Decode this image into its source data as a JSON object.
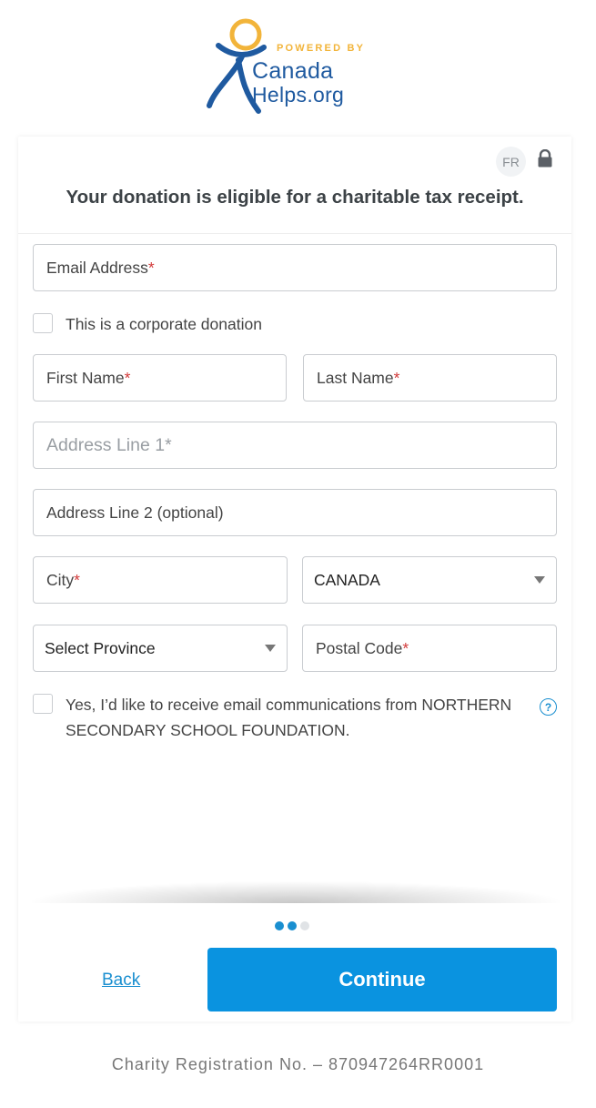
{
  "logo": {
    "powered_by": "POWERED BY",
    "line1": "Canada",
    "line2_main": "Helps",
    "line2_suffix": ".org"
  },
  "header": {
    "language_toggle": "FR",
    "lock_icon": "lock-icon",
    "title": "Your donation is eligible for a charitable tax receipt."
  },
  "form": {
    "email": {
      "label": "Email Address",
      "required_mark": "*"
    },
    "corporate_checkbox": {
      "label": "This is a corporate donation",
      "checked": false
    },
    "first_name": {
      "label": "First Name",
      "required_mark": "*"
    },
    "last_name": {
      "label": "Last Name",
      "required_mark": "*"
    },
    "address1": {
      "placeholder": "Address Line 1*"
    },
    "address2": {
      "label": "Address Line 2 (optional)"
    },
    "city": {
      "label": "City",
      "required_mark": "*"
    },
    "country": {
      "selected": "CANADA"
    },
    "province": {
      "selected": "Select Province"
    },
    "postal": {
      "label": "Postal Code",
      "required_mark": "*"
    },
    "email_opt_in": {
      "label": "Yes, I’d like to receive email communications from NORTHERN SECONDARY SCHOOL FOUNDATION.",
      "checked": false,
      "help_glyph": "?"
    }
  },
  "progress": {
    "step": 2,
    "total": 3
  },
  "actions": {
    "back": "Back",
    "continue": "Continue"
  },
  "footer": {
    "charity_registration": "Charity Registration No. – 870947264RR0001"
  },
  "colors": {
    "accent": "#0a93e0",
    "required": "#d23a3a",
    "logo_blue": "#1f5aa0",
    "logo_yellow": "#f2b43a"
  }
}
